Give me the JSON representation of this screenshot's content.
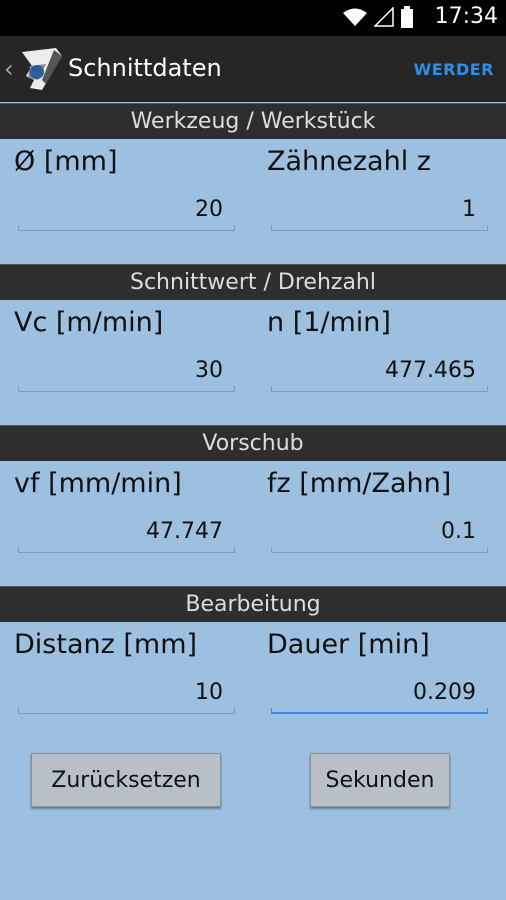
{
  "status": {
    "time": "17:34"
  },
  "app": {
    "title": "Schnittdaten",
    "brand": "WERDER"
  },
  "sections": [
    {
      "title": "Werkzeug / Werkstück",
      "left_label": "Ø [mm]",
      "left_value": "20",
      "right_label": "Zähnezahl z",
      "right_value": "1"
    },
    {
      "title": "Schnittwert / Drehzahl",
      "left_label": "Vc [m/min]",
      "left_value": "30",
      "right_label": "n [1/min]",
      "right_value": "477.465"
    },
    {
      "title": "Vorschub",
      "left_label": "vf [mm/min]",
      "left_value": "47.747",
      "right_label": "fz [mm/Zahn]",
      "right_value": "0.1"
    },
    {
      "title": "Bearbeitung",
      "left_label": "Distanz [mm]",
      "left_value": "10",
      "right_label": "Dauer [min]",
      "right_value": "0.209"
    }
  ],
  "buttons": {
    "reset": "Zurücksetzen",
    "seconds": "Sekunden"
  },
  "colors": {
    "background": "#9dbfe0",
    "header": "#2e2e2e",
    "accent": "#2f8fe6"
  }
}
